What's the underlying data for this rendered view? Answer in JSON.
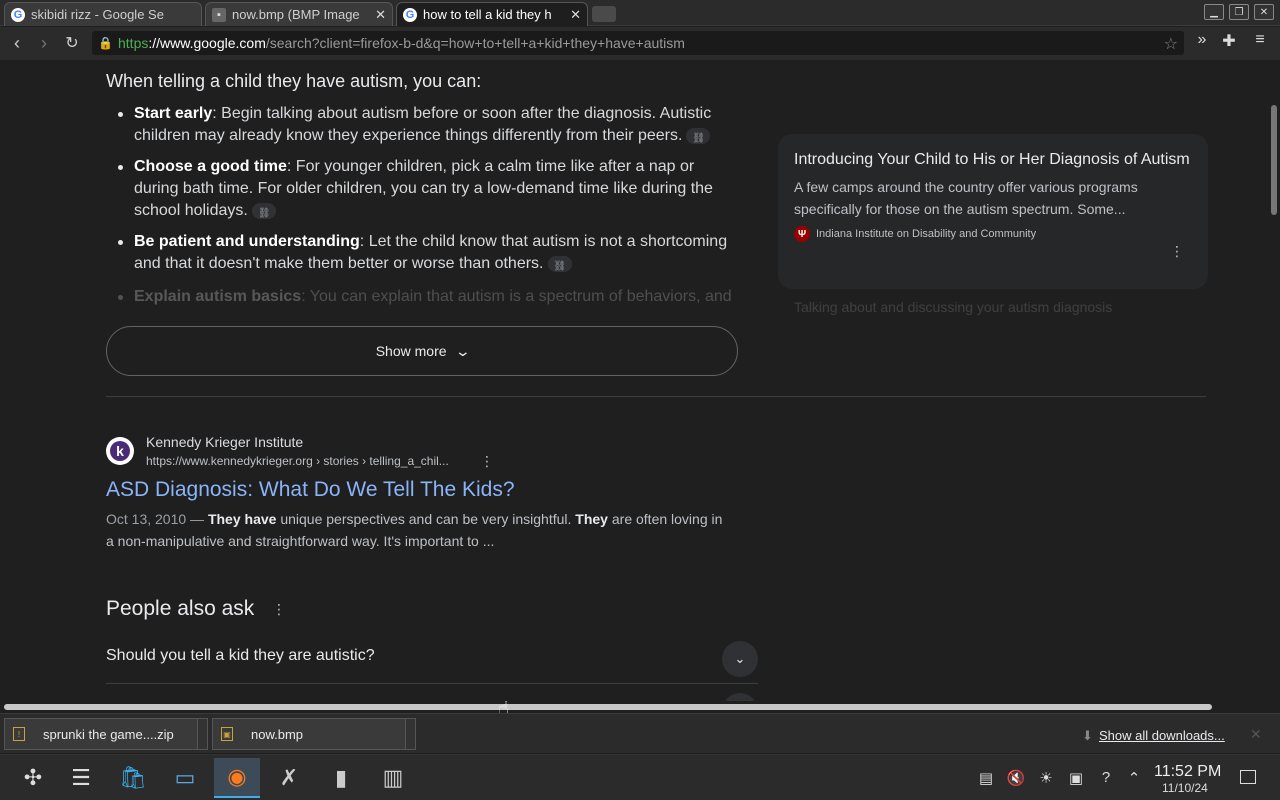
{
  "tabs": [
    {
      "label": "skibidi rizz - Google Se",
      "icon": "G"
    },
    {
      "label": "now.bmp (BMP Image",
      "icon": "img"
    },
    {
      "label": "how to tell a kid they h",
      "icon": "G"
    }
  ],
  "url": {
    "scheme": "https",
    "host": "://www.google.com",
    "rest": "/search?client=firefox-b-d&q=how+to+tell+a+kid+they+have+autism"
  },
  "overview": {
    "intro": "When telling a child they have autism, you can:",
    "bullets": [
      {
        "term": "Start early",
        "text": ": Begin talking about autism before or soon after the diagnosis. Autistic children may already know they experience things differently from their peers."
      },
      {
        "term": "Choose a good time",
        "text": ": For younger children, pick a calm time like after a nap or during bath time. For older children, you can try a low-demand time like during the school holidays."
      },
      {
        "term": "Be patient and understanding",
        "text": ": Let the child know that autism is not a shortcoming and that it doesn't make them better or worse than others."
      }
    ],
    "faded": {
      "term": "Explain autism basics",
      "text": ": You can explain that autism is a spectrum of behaviors, and"
    },
    "show_more": "Show more"
  },
  "side_card": {
    "title": "Introducing Your Child to His or Her Diagnosis of Autism",
    "snippet": "A few camps around the country offer various programs specifically for those on the autism spectrum. Some...",
    "source": "Indiana Institute on Disability and Community",
    "faded": "Talking about and discussing your autism diagnosis"
  },
  "result": {
    "site": "Kennedy Krieger Institute",
    "url": "https://www.kennedykrieger.org › stories › telling_a_chil...",
    "title": "ASD Diagnosis: What Do We Tell The Kids?",
    "date": "Oct 13, 2010 —",
    "snippet_a": "They have",
    "snippet_b": " unique perspectives and can be very insightful. ",
    "snippet_c": "They",
    "snippet_d": " are often loving in a non-manipulative and straightforward way. It's important to ..."
  },
  "paa": {
    "title": "People also ask",
    "questions": [
      "Should you tell a kid they are autistic?"
    ]
  },
  "downloads": {
    "items": [
      "sprunki the game....zip",
      "now.bmp"
    ],
    "show_all": "Show all downloads..."
  },
  "clock": {
    "time": "11:52 PM",
    "date": "11/10/24"
  },
  "colors": {
    "link": "#8ab4f8",
    "background": "#1f1f1f",
    "accent": "#3daee9"
  }
}
